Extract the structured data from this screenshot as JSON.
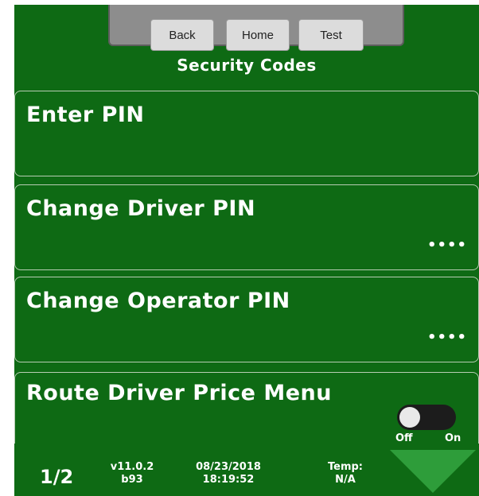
{
  "header": {
    "buttons": {
      "back": "Back",
      "home": "Home",
      "test": "Test"
    },
    "title": "Security Codes"
  },
  "menu": {
    "items": [
      {
        "label": "Enter PIN",
        "value": ""
      },
      {
        "label": "Change Driver PIN",
        "value": "••••"
      },
      {
        "label": "Change Operator PIN",
        "value": "••••"
      },
      {
        "label": "Route Driver Price Menu",
        "value": ""
      }
    ]
  },
  "toggle": {
    "state": "off",
    "off_label": "Off",
    "on_label": "On"
  },
  "footer": {
    "page": "1/2",
    "version_line1": "v11.0.2",
    "version_line2": "b93",
    "date": "08/23/2018",
    "time": "18:19:52",
    "temp_label": "Temp:",
    "temp_value": "N/A"
  },
  "colors": {
    "background": "#0e6a14",
    "header_tray": "#8d8d8d",
    "button_face": "#dcdcdc",
    "item_border": "#b7ccb3",
    "next_arrow": "#2e9d3a",
    "toggle_track": "#1c1c1c"
  },
  "icons": {
    "next_page": "triangle-down-icon",
    "toggle_knob": "circle-knob"
  }
}
